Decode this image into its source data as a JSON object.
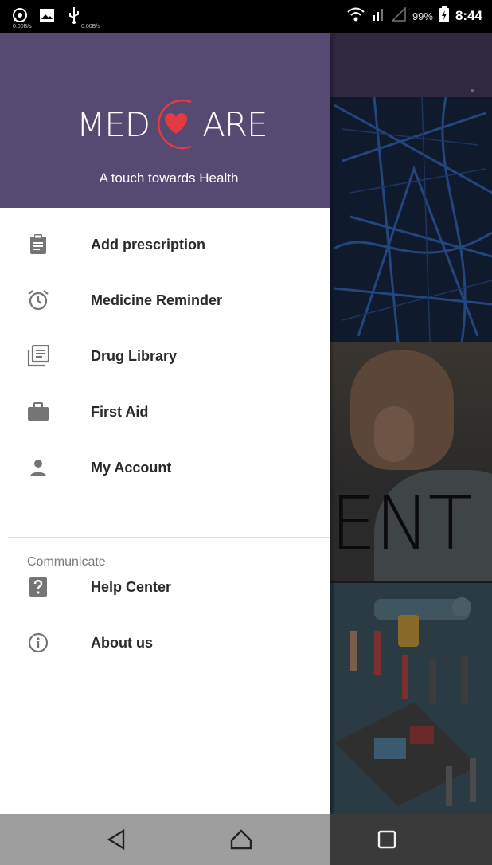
{
  "status_bar": {
    "battery_percent": "99%",
    "time": "8:44",
    "net_speed_1": "0.00B/s",
    "net_speed_2": "0.00B/s"
  },
  "drawer": {
    "logo_left": "MED",
    "logo_right": "ARE",
    "tagline": "A touch towards Health",
    "brand_color": "#574a72",
    "accent_color": "#e23b43",
    "items": [
      {
        "label": "Add prescription",
        "icon": "clipboard-icon"
      },
      {
        "label": "Medicine Reminder",
        "icon": "alarm-icon"
      },
      {
        "label": "Drug Library",
        "icon": "library-icon"
      },
      {
        "label": "First Aid",
        "icon": "briefcase-icon"
      },
      {
        "label": "My Account",
        "icon": "person-icon"
      }
    ],
    "section_title": "Communicate",
    "section_items": [
      {
        "label": "Help Center",
        "icon": "help-icon"
      },
      {
        "label": "About us",
        "icon": "info-icon"
      }
    ]
  },
  "background": {
    "banner_text": "MENT"
  },
  "nav_bar": {
    "back": "back-icon",
    "home": "home-icon",
    "recents": "recents-icon"
  }
}
